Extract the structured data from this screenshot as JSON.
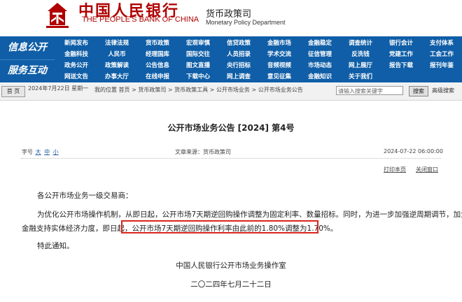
{
  "header": {
    "bank_name_cn": "中国人民银行",
    "bank_name_en": "THE PEOPLE'S BANK OF CHINA",
    "dept_cn": "货币政策司",
    "dept_en": "Monetary Policy Department",
    "brand_color": "#b00000"
  },
  "nav": {
    "bg_color": "#0f5ea7",
    "label_info": "信息公开",
    "label_service": "服务互动",
    "rows": [
      [
        "新闻发布",
        "法律法规",
        "货币政策",
        "宏观审慎",
        "信贷政策",
        "金融市场",
        "金融稳定",
        "调查统计",
        "银行会计",
        "支付体系"
      ],
      [
        "金融科技",
        "人民币",
        "经理国库",
        "国际交往",
        "人员招录",
        "学术交流",
        "征信管理",
        "反洗钱",
        "党建工作",
        "工会工作"
      ],
      [
        "政务公开",
        "政策解读",
        "公告信息",
        "图文直播",
        "央行招标",
        "音频视频",
        "市场动态",
        "网上展厅",
        "报告下载",
        "报刊年鉴"
      ],
      [
        "网送文告",
        "办事大厅",
        "在线申报",
        "下载中心",
        "网上调查",
        "意见征集",
        "金融知识",
        "关于我们",
        "",
        ""
      ]
    ]
  },
  "breadcrumb": {
    "home_label": "首 页",
    "date": "2024年7月22日 星期一",
    "location": "我的位置 首页 > 货币政策司 > 货币政策工具 > 公开市场业务 > 公开市场业务公告",
    "search_placeholder": "请输入搜索关键字",
    "search_button": "搜索",
    "advanced_search": "高级搜索"
  },
  "article": {
    "title": "公开市场业务公告  [2024] 第4号",
    "font_label": "字号",
    "font_sizes": [
      "大",
      "中",
      "小"
    ],
    "source": "文章来源：货币政策司",
    "datetime": "2024-07-22 06:00:00",
    "print_label": "打印本页",
    "close_label": "关闭窗口",
    "salutation": "各公开市场业务一级交易商：",
    "para_line1": "为优化公开市场操作机制，从即日起，公开市场7天期逆回购操作调整为固定利率、数量招标。同时，为进一步加强逆周期调节，加大",
    "para_line2_prefix": "金融支持实体经济力度，即日起，",
    "para_line2_highlight": "公开市场7天期逆回购操作利率由此前的1.80%调整为1.70%。",
    "closing": "特此通知。",
    "signature": "中国人民银行公开市场业务操作室",
    "sign_date": "二〇二四年七月二十二日",
    "highlight_color": "#d9251d"
  }
}
